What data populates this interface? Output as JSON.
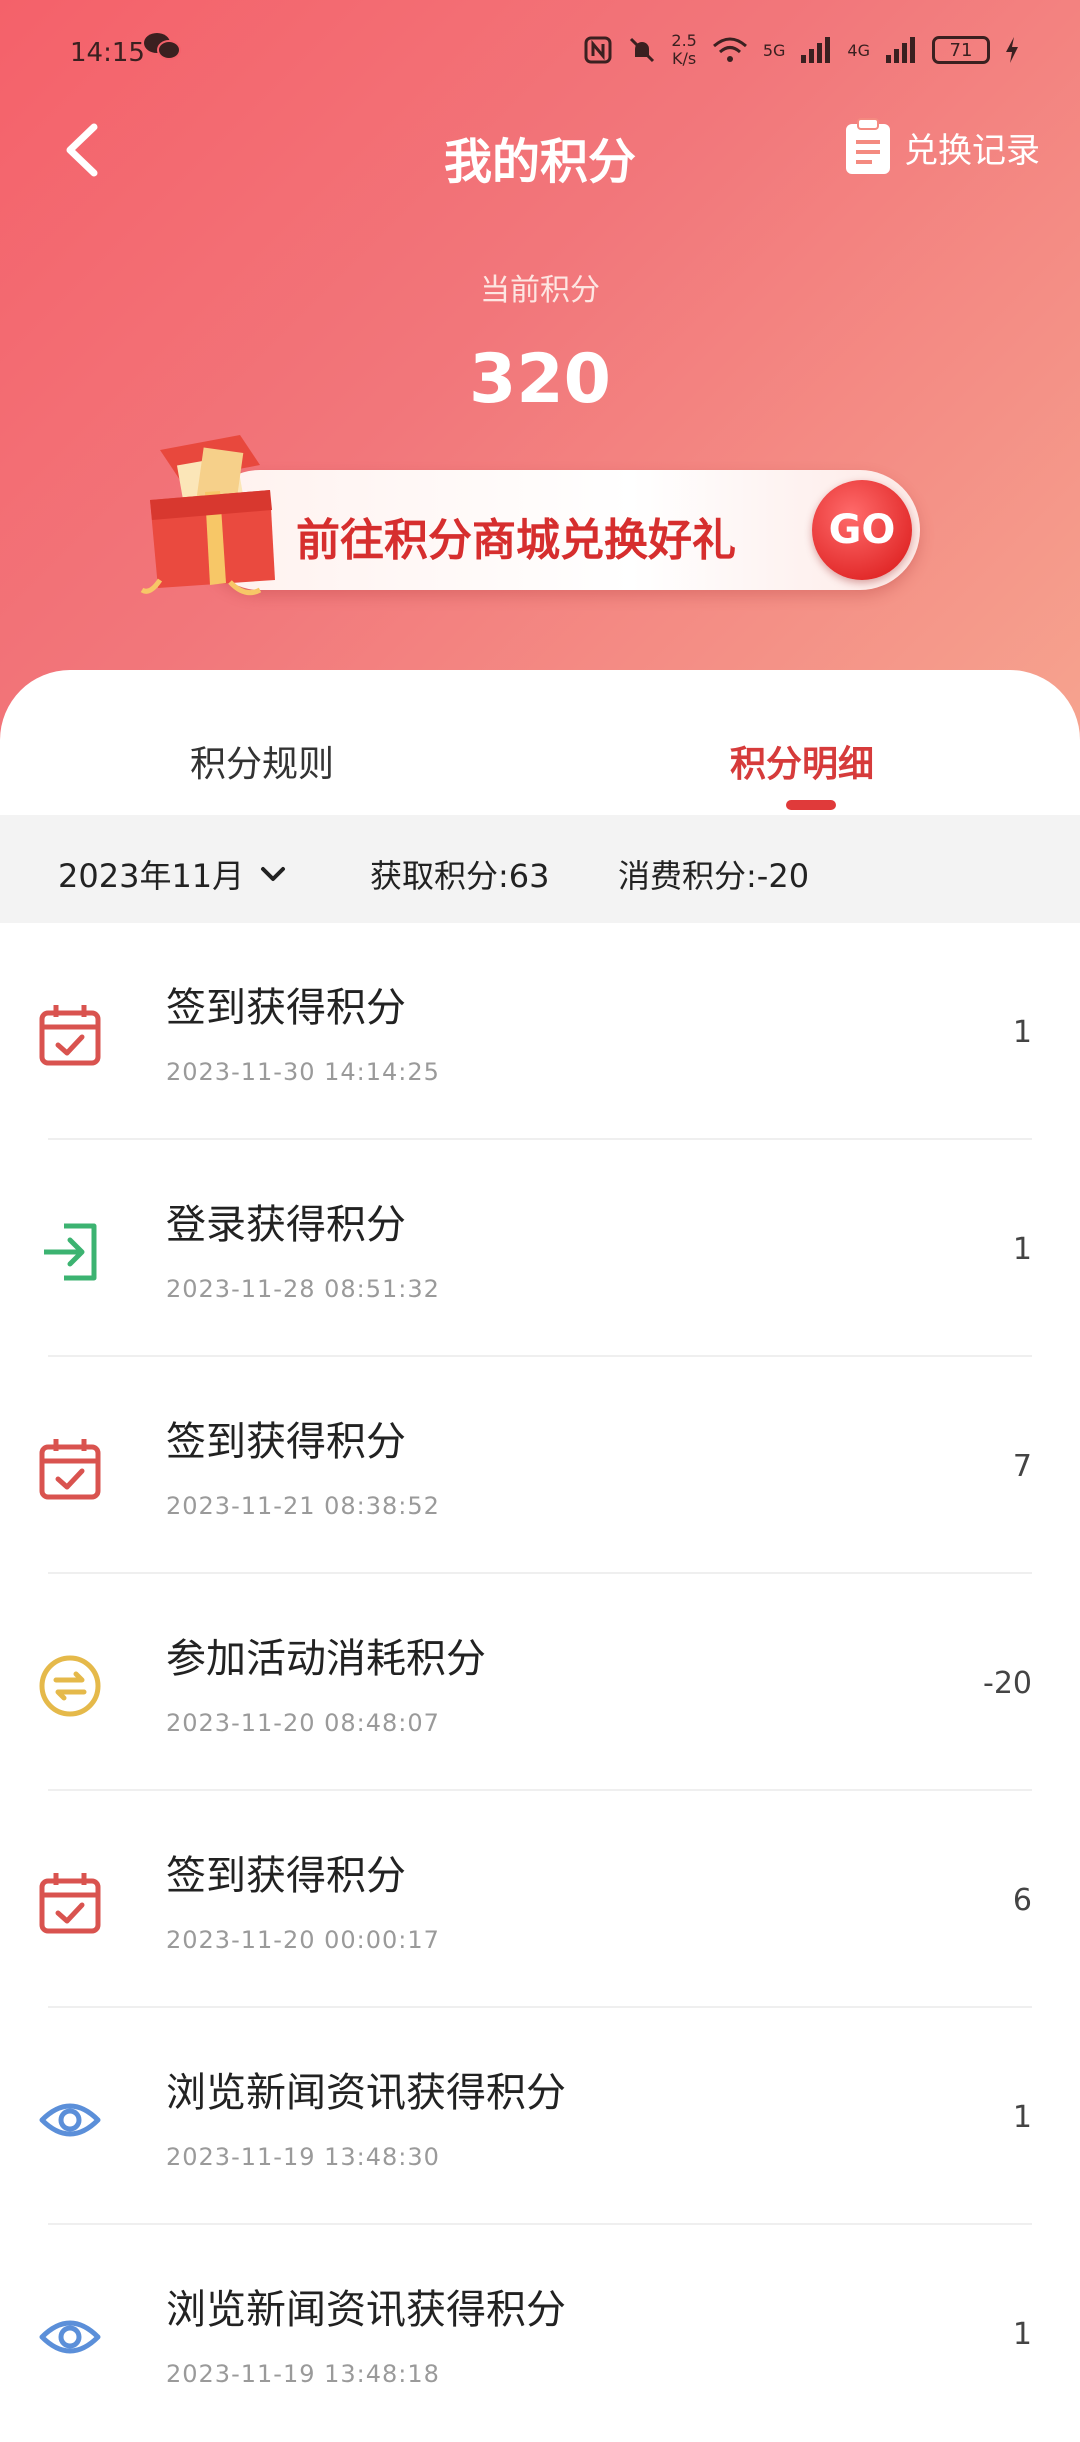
{
  "status_bar": {
    "time": "14:15",
    "net_speed_value": "2.5",
    "net_speed_unit": "K/s",
    "signal_1": "5G",
    "signal_2": "4G",
    "battery": "71"
  },
  "nav": {
    "title": "我的积分",
    "exchange_link": "兑换记录"
  },
  "points": {
    "label": "当前积分",
    "value": "320"
  },
  "mall_banner": {
    "text": "前往积分商城兑换好礼",
    "go": "GO"
  },
  "tabs": [
    {
      "label": "积分规则"
    },
    {
      "label": "积分明细"
    }
  ],
  "filter": {
    "month": "2023年11月",
    "earned": "获取积分:63",
    "spent": "消费积分:-20"
  },
  "records": [
    {
      "icon": "calendar-check-icon",
      "title": "签到获得积分",
      "time": "2023-11-30 14:14:25",
      "value": "1"
    },
    {
      "icon": "login-icon",
      "title": "登录获得积分",
      "time": "2023-11-28 08:51:32",
      "value": "1"
    },
    {
      "icon": "calendar-check-icon",
      "title": "签到获得积分",
      "time": "2023-11-21 08:38:52",
      "value": "7"
    },
    {
      "icon": "exchange-icon",
      "title": "参加活动消耗积分",
      "time": "2023-11-20 08:48:07",
      "value": "-20"
    },
    {
      "icon": "calendar-check-icon",
      "title": "签到获得积分",
      "time": "2023-11-20 00:00:17",
      "value": "6"
    },
    {
      "icon": "eye-icon",
      "title": "浏览新闻资讯获得积分",
      "time": "2023-11-19 13:48:30",
      "value": "1"
    },
    {
      "icon": "eye-icon",
      "title": "浏览新闻资讯获得积分",
      "time": "2023-11-19 13:48:18",
      "value": "1"
    }
  ],
  "colors": {
    "header_start": "#f4616a",
    "header_end": "#f6a48f",
    "accent_red": "#d63b3b",
    "calendar_icon": "#d9534f",
    "login_icon": "#3cb371",
    "exchange_icon": "#e5b94a",
    "eye_icon": "#5b8fd9"
  }
}
